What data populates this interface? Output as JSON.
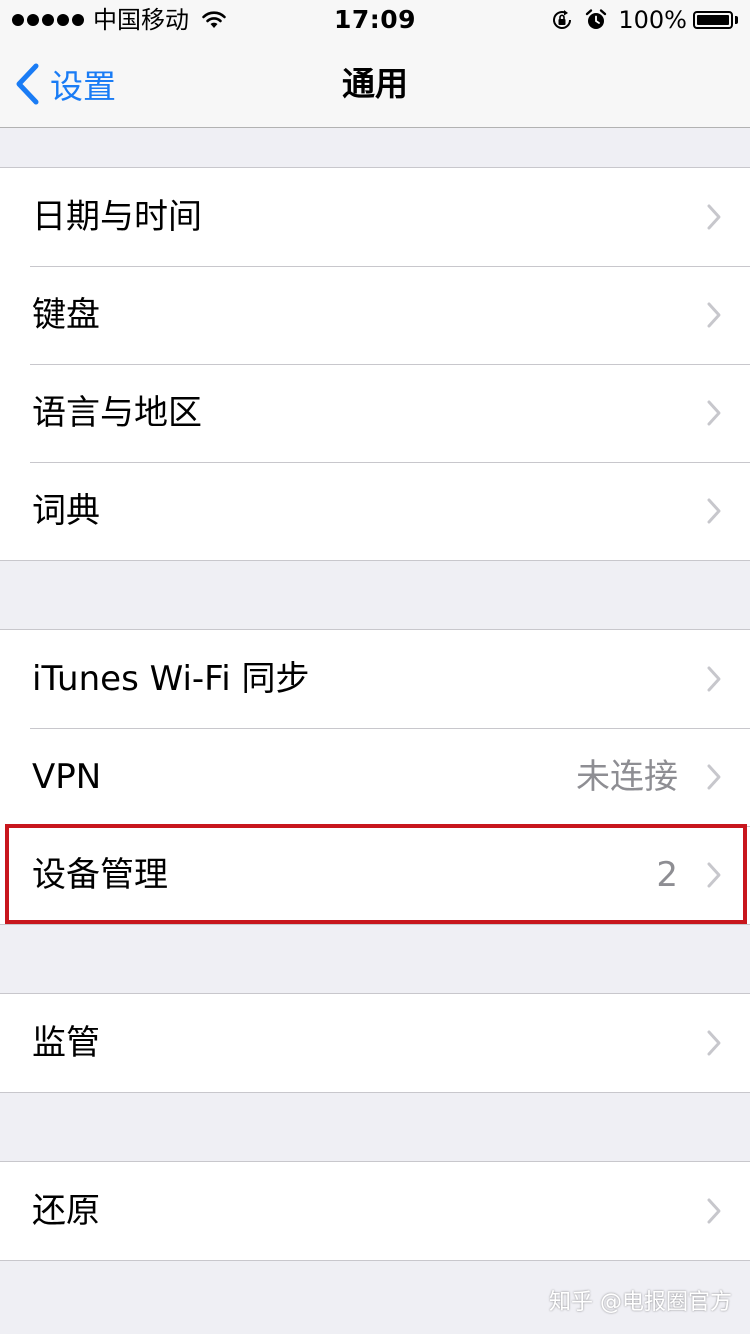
{
  "status_bar": {
    "carrier": "中国移动",
    "time": "17:09",
    "battery_percent": "100%",
    "battery_level": 1.0,
    "icons": [
      "signal-dots-icon",
      "wifi-icon",
      "orientation-lock-icon",
      "alarm-icon",
      "battery-icon"
    ]
  },
  "nav": {
    "back_label": "设置",
    "title": "通用"
  },
  "groups": [
    {
      "rows": [
        {
          "label": "日期与时间",
          "value": ""
        },
        {
          "label": "键盘",
          "value": ""
        },
        {
          "label": "语言与地区",
          "value": ""
        },
        {
          "label": "词典",
          "value": ""
        }
      ]
    },
    {
      "rows": [
        {
          "label": "iTunes Wi-Fi 同步",
          "value": ""
        },
        {
          "label": "VPN",
          "value": "未连接"
        },
        {
          "label": "设备管理",
          "value": "2"
        }
      ]
    },
    {
      "rows": [
        {
          "label": "监管",
          "value": ""
        }
      ]
    },
    {
      "rows": [
        {
          "label": "还原",
          "value": ""
        }
      ]
    }
  ],
  "highlight_color": "#c8161d",
  "accent_color": "#1a7cf5",
  "watermark": "知乎 @电报圈官方"
}
